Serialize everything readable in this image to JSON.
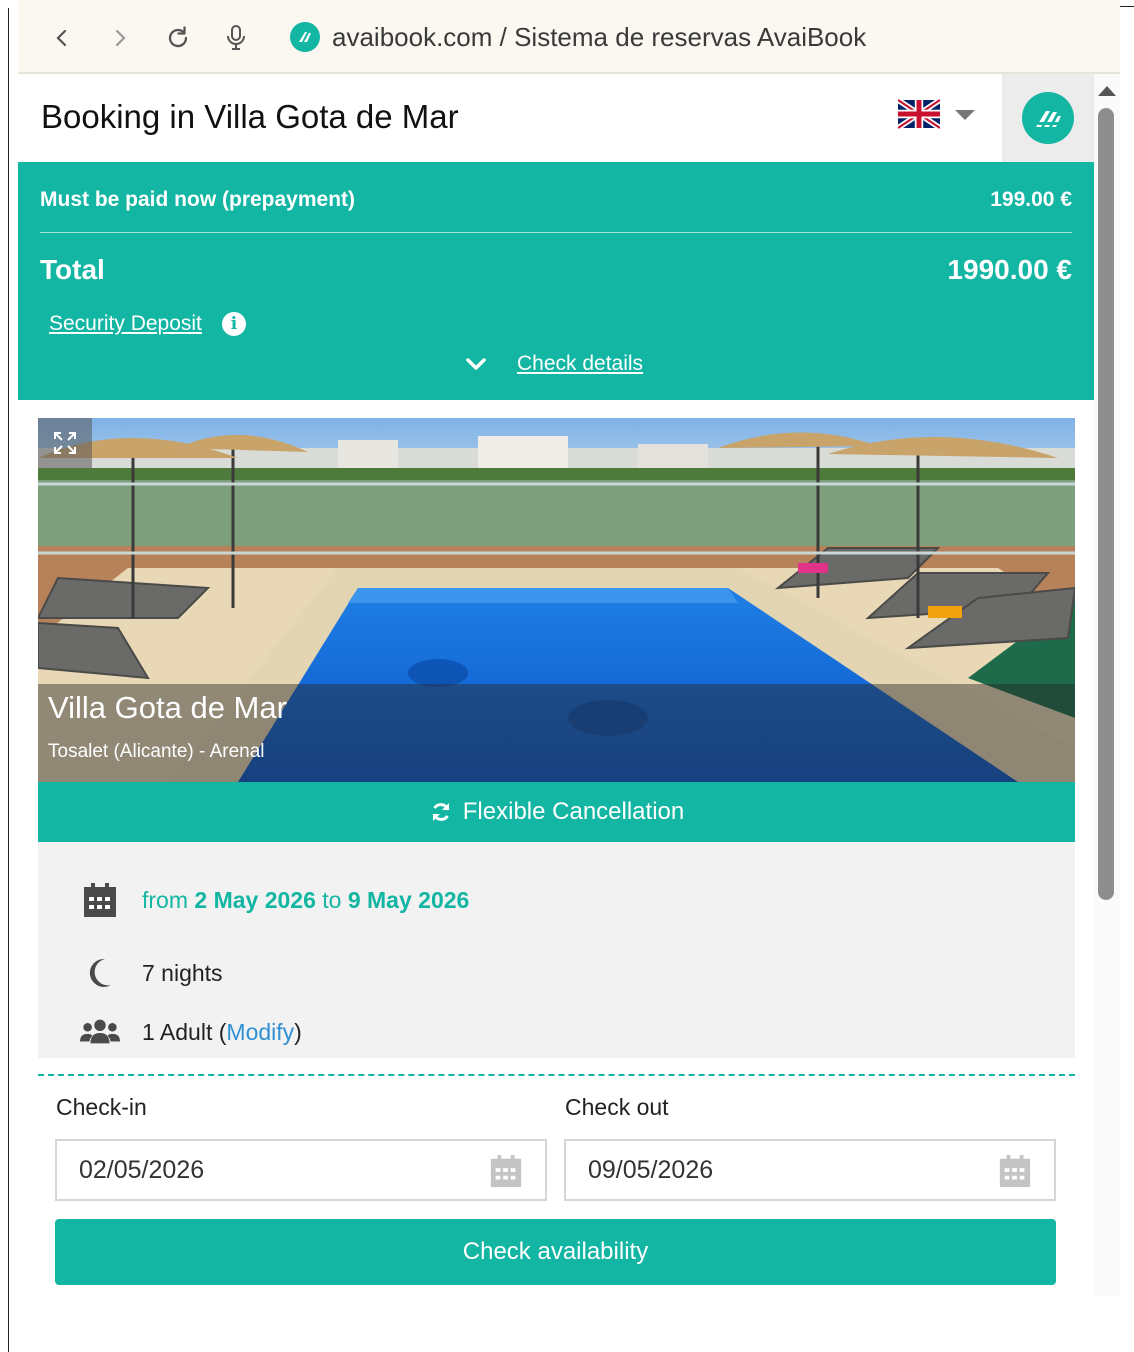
{
  "browser": {
    "url_text": "avaibook.com / Sistema de reservas AvaiBook",
    "icons": [
      "back-icon",
      "forward-icon",
      "reload-icon",
      "microphone-icon",
      "site-icon"
    ]
  },
  "header": {
    "title": "Booking in Villa Gota de Mar",
    "language_icon": "uk-flag-icon"
  },
  "summary": {
    "prepay_label": "Must be paid now (prepayment)",
    "prepay_value": "199.00 €",
    "total_label": "Total",
    "total_value": "1990.00 €",
    "deposit_link": "Security Deposit",
    "details_link": "Check details"
  },
  "property": {
    "name": "Villa Gota de Mar",
    "location": "Tosalet (Alicante) - Arenal",
    "cancellation": "Flexible Cancellation"
  },
  "stay": {
    "from_word": "from",
    "start_date": "2 May 2026",
    "to_word": "to",
    "end_date": "9 May 2026",
    "nights": "7 nights",
    "guests": "1 Adult",
    "paren_open": "(",
    "modify_link": "Modify",
    "paren_close": ")"
  },
  "form": {
    "checkin_label": "Check-in",
    "checkin_value": "02/05/2026",
    "checkout_label": "Check out",
    "checkout_value": "09/05/2026",
    "submit_label": "Check availability"
  },
  "colors": {
    "accent": "#13b5a3",
    "link": "#2f8fd4"
  }
}
